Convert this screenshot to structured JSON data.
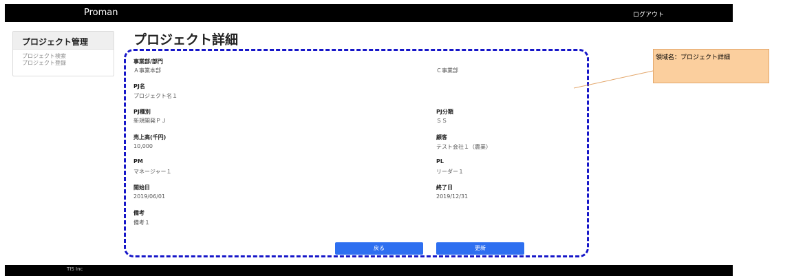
{
  "header": {
    "brand": "Proman",
    "logout_label": "ログアウト"
  },
  "sidebar": {
    "title": "プロジェクト管理",
    "links": [
      "プロジェクト検索",
      "プロジェクト登録"
    ]
  },
  "main": {
    "title": "プロジェクト詳細",
    "fields": {
      "division_label": "事業部/部門",
      "division_value": "Ａ事業本部",
      "department_value": "Ｃ事業部",
      "pj_name_label": "PJ名",
      "pj_name_value": "プロジェクト名１",
      "pj_type_label": "PJ種別",
      "pj_type_value": "新規開発ＰＪ",
      "pj_class_label": "PJ分類",
      "pj_class_value": "ＳＳ",
      "sales_label": "売上高(千円)",
      "sales_value": "10,000",
      "client_label": "顧客",
      "client_value": "テスト会社１（農業）",
      "pm_label": "PM",
      "pm_value": "マネージャー１",
      "pl_label": "PL",
      "pl_value": "リーダー１",
      "start_label": "開始日",
      "start_value": "2019/06/01",
      "end_label": "終了日",
      "end_value": "2019/12/31",
      "remarks_label": "備考",
      "remarks_value": "備考１"
    },
    "back_button": "戻る",
    "update_button": "更新"
  },
  "annotation": {
    "text": "領域名：プロジェクト詳細",
    "region_color": "#1616c8",
    "note_color": "#fbcf9e"
  },
  "footer": {
    "copyright": "TIS Inc"
  }
}
